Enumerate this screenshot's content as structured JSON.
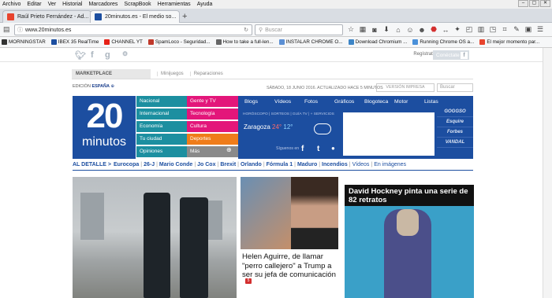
{
  "menubar": {
    "items": [
      "Archivo",
      "Editar",
      "Ver",
      "Historial",
      "Marcadores",
      "ScrapBook",
      "Herramientas",
      "Ayuda"
    ]
  },
  "tabs": [
    {
      "title": "Raúl Prieto Fernández - Ad...",
      "favicon_color": "#e8442e"
    },
    {
      "title": "20minutos.es - El medio so...",
      "favicon_color": "#1c4ea0"
    }
  ],
  "navbar": {
    "url": "www.20minutos.es",
    "search_placeholder": "Buscar"
  },
  "bookmarks": [
    {
      "label": "MORNINGSTAR",
      "color": "#333"
    },
    {
      "label": "IBEX 35 RealTime",
      "color": "#1c4ea0"
    },
    {
      "label": "CHANNEL YT",
      "color": "#e62117"
    },
    {
      "label": "SpamLoco - Seguridad...",
      "color": "#c0392b"
    },
    {
      "label": "How to take a full-len...",
      "color": "#666"
    },
    {
      "label": "INSTALAR CHROME O...",
      "color": "#5b8fd4"
    },
    {
      "label": "Download Chromium ...",
      "color": "#3d85c6"
    },
    {
      "label": "Running Chrome OS a...",
      "color": "#4a90d9"
    },
    {
      "label": "El mejor momento par...",
      "color": "#e8442e"
    }
  ],
  "site": {
    "login": "Regístrate  |  Iniciar sesión",
    "connect": "Conéctate",
    "marketplace": {
      "label": "MARKETPLACE",
      "links": [
        "Minijuegos",
        "Reparaciones"
      ]
    },
    "edicion": "EDICIÓN",
    "edicion_country": "ESPAÑA",
    "dateline": "SÁBADO, 18 JUNIO 2016. ACTUALIZADO HACE 5 MINUTOS",
    "version_impresa": "VERSIÓN IMPRESA",
    "buscar": "Buscar",
    "logo": {
      "number": "20",
      "word": "minutos"
    },
    "sections_col1": [
      "Nacional",
      "Internacional",
      "Economía",
      "Tu ciudad",
      "Opiniones"
    ],
    "sections_col2": [
      "Gente y TV",
      "Tecnología",
      "Cultura",
      "Deportes",
      "Más"
    ],
    "top_nav": [
      "Blogs",
      "Vídeos",
      "Fotos",
      "Gráficos",
      "Blogoteca",
      "Motor",
      "Listas"
    ],
    "sub_nav": "HORÓSCOPO  |  SORTEOS  |  GUÍA TV  |  + SERVICIOS",
    "weather": {
      "city": "Zaragoza",
      "high": "24°",
      "low": "12°"
    },
    "siguenos": "Síguenos en",
    "partners": [
      "GOGGSO",
      "Esquire",
      "Forbes",
      "VANDAL"
    ],
    "hotbar": {
      "lead": "AL DETALLE >",
      "items": [
        "Eurocopa",
        "26-J",
        "Mario Conde",
        "Jo Cox",
        "Brexit",
        "Orlando",
        "Fórmula 1",
        "Maduro",
        "Incendios"
      ],
      "extra": [
        "Vídeos",
        "En imágenes"
      ]
    },
    "story2": {
      "caption": "Helen Aguirre, de llamar \"perro callejero\" a Trump a ser su jefa de comunicación",
      "count": "5"
    },
    "story3": {
      "title": "David Hockney pinta una serie de 82 retratos"
    }
  }
}
